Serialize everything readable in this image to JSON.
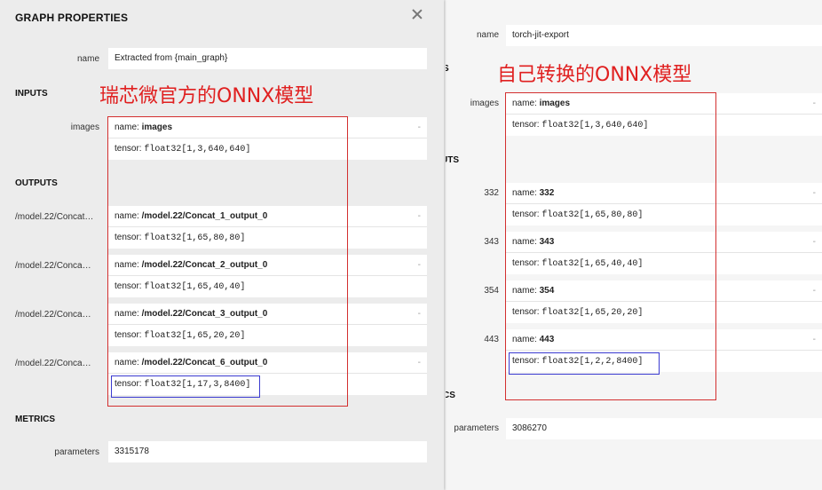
{
  "left": {
    "title": "GRAPH PROPERTIES",
    "name_label": "name",
    "name_value": "Extracted from {main_graph}",
    "inputs_header": "INPUTS",
    "input": {
      "label": "images",
      "name_prefix": "name:",
      "name": "images",
      "tensor_prefix": "tensor:",
      "tensor": "float32[1,3,640,640]"
    },
    "outputs_header": "OUTPUTS",
    "outputs": [
      {
        "label": "/model.22/Concat…",
        "name_prefix": "name:",
        "name": "/model.22/Concat_1_output_0",
        "tensor_prefix": "tensor:",
        "tensor": "float32[1,65,80,80]"
      },
      {
        "label": "/model.22/Conca…",
        "name_prefix": "name:",
        "name": "/model.22/Concat_2_output_0",
        "tensor_prefix": "tensor:",
        "tensor": "float32[1,65,40,40]"
      },
      {
        "label": "/model.22/Conca…",
        "name_prefix": "name:",
        "name": "/model.22/Concat_3_output_0",
        "tensor_prefix": "tensor:",
        "tensor": "float32[1,65,20,20]"
      },
      {
        "label": "/model.22/Conca…",
        "name_prefix": "name:",
        "name": "/model.22/Concat_6_output_0",
        "tensor_prefix": "tensor:",
        "tensor": "float32[1,17,3,8400]"
      }
    ],
    "metrics_header": "METRICS",
    "parameters_label": "parameters",
    "parameters_value": "3315178",
    "annotation": "瑞芯微官方的ONNX模型"
  },
  "right": {
    "name_label": "name",
    "name_value": "torch-jit-export",
    "inputs_header_partial": "S",
    "input": {
      "label": "images",
      "name_prefix": "name:",
      "name": "images",
      "tensor_prefix": "tensor:",
      "tensor": "float32[1,3,640,640]"
    },
    "outputs_header_partial": "UTS",
    "outputs": [
      {
        "label": "332",
        "name_prefix": "name:",
        "name": "332",
        "tensor_prefix": "tensor:",
        "tensor": "float32[1,65,80,80]"
      },
      {
        "label": "343",
        "name_prefix": "name:",
        "name": "343",
        "tensor_prefix": "tensor:",
        "tensor": "float32[1,65,40,40]"
      },
      {
        "label": "354",
        "name_prefix": "name:",
        "name": "354",
        "tensor_prefix": "tensor:",
        "tensor": "float32[1,65,20,20]"
      },
      {
        "label": "443",
        "name_prefix": "name:",
        "name": "443",
        "tensor_prefix": "tensor:",
        "tensor": "float32[1,2,2,8400]"
      }
    ],
    "metrics_header_partial": "CS",
    "parameters_label": "parameters",
    "parameters_value": "3086270",
    "annotation": "自己转换的ONNX模型"
  },
  "dash": "-",
  "colors": {
    "annotation_red": "#e02020",
    "highlight_blue": "#3a3ad0"
  }
}
